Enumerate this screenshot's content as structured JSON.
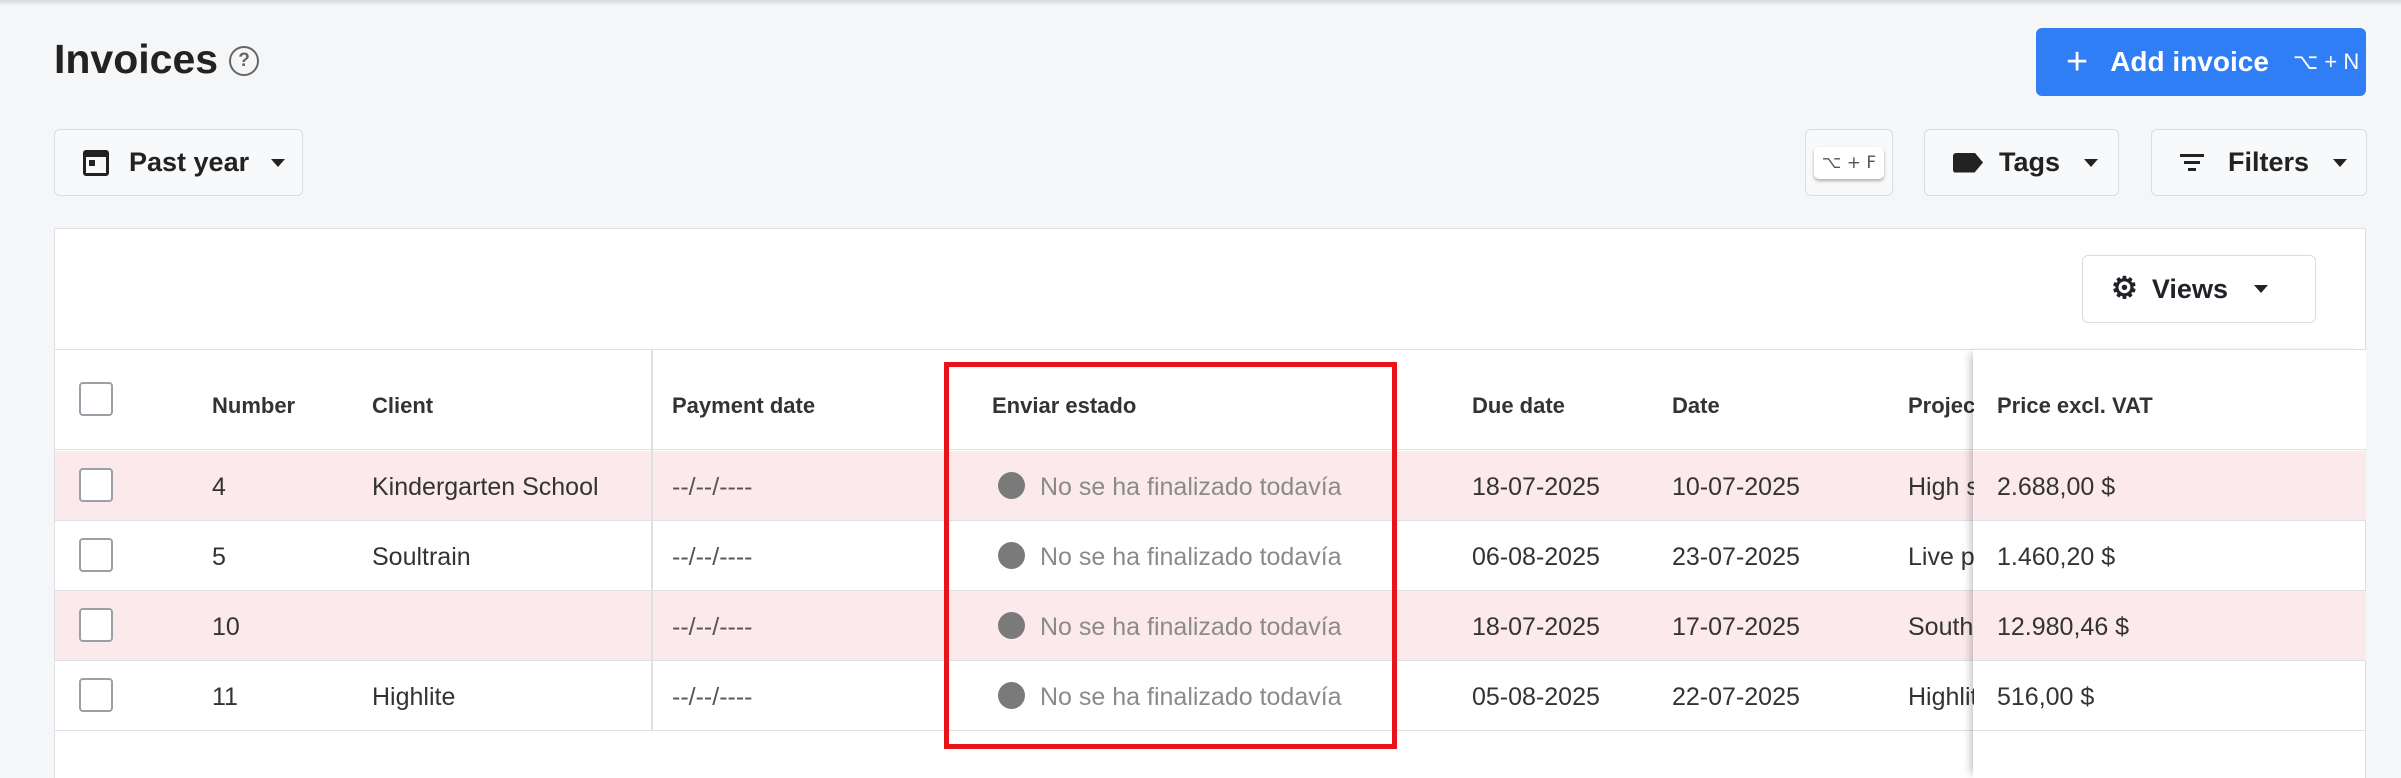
{
  "page": {
    "title": "Invoices"
  },
  "header": {
    "add_button": {
      "label": "Add invoice",
      "shortcut": "⌥ + N"
    }
  },
  "toolbar": {
    "period": "Past year",
    "filter_shortcut": "⌥ + F",
    "tags": "Tags",
    "filters": "Filters",
    "views": "Views"
  },
  "table": {
    "columns": {
      "number": "Number",
      "client": "Client",
      "payment_date": "Payment date",
      "status": "Enviar estado",
      "due_date": "Due date",
      "date": "Date",
      "project": "Project",
      "price": "Price excl. VAT"
    },
    "rows": [
      {
        "number": "4",
        "client": "Kindergarten School",
        "payment_date": "--/--/----",
        "status": "No se ha finalizado todavía",
        "due_date": "18-07-2025",
        "date": "10-07-2025",
        "project": "High s",
        "price": "2.688,00 $",
        "highlighted": true
      },
      {
        "number": "5",
        "client": "Soultrain",
        "payment_date": "--/--/----",
        "status": "No se ha finalizado todavía",
        "due_date": "06-08-2025",
        "date": "23-07-2025",
        "project": "Live pe",
        "price": "1.460,20 $",
        "highlighted": false
      },
      {
        "number": "10",
        "client": "",
        "payment_date": "--/--/----",
        "status": "No se ha finalizado todavía",
        "due_date": "18-07-2025",
        "date": "17-07-2025",
        "project": "South",
        "price": "12.980,46 $",
        "highlighted": true
      },
      {
        "number": "11",
        "client": "Highlite",
        "payment_date": "--/--/----",
        "status": "No se ha finalizado todavía",
        "due_date": "05-08-2025",
        "date": "22-07-2025",
        "project": "Highlit",
        "price": "516,00 $",
        "highlighted": false
      }
    ]
  },
  "colors": {
    "accent": "#2f7ef5",
    "row_highlight": "#fbe9ec",
    "annotation": "#e8141a",
    "status_dot": "#7a7a7a"
  }
}
